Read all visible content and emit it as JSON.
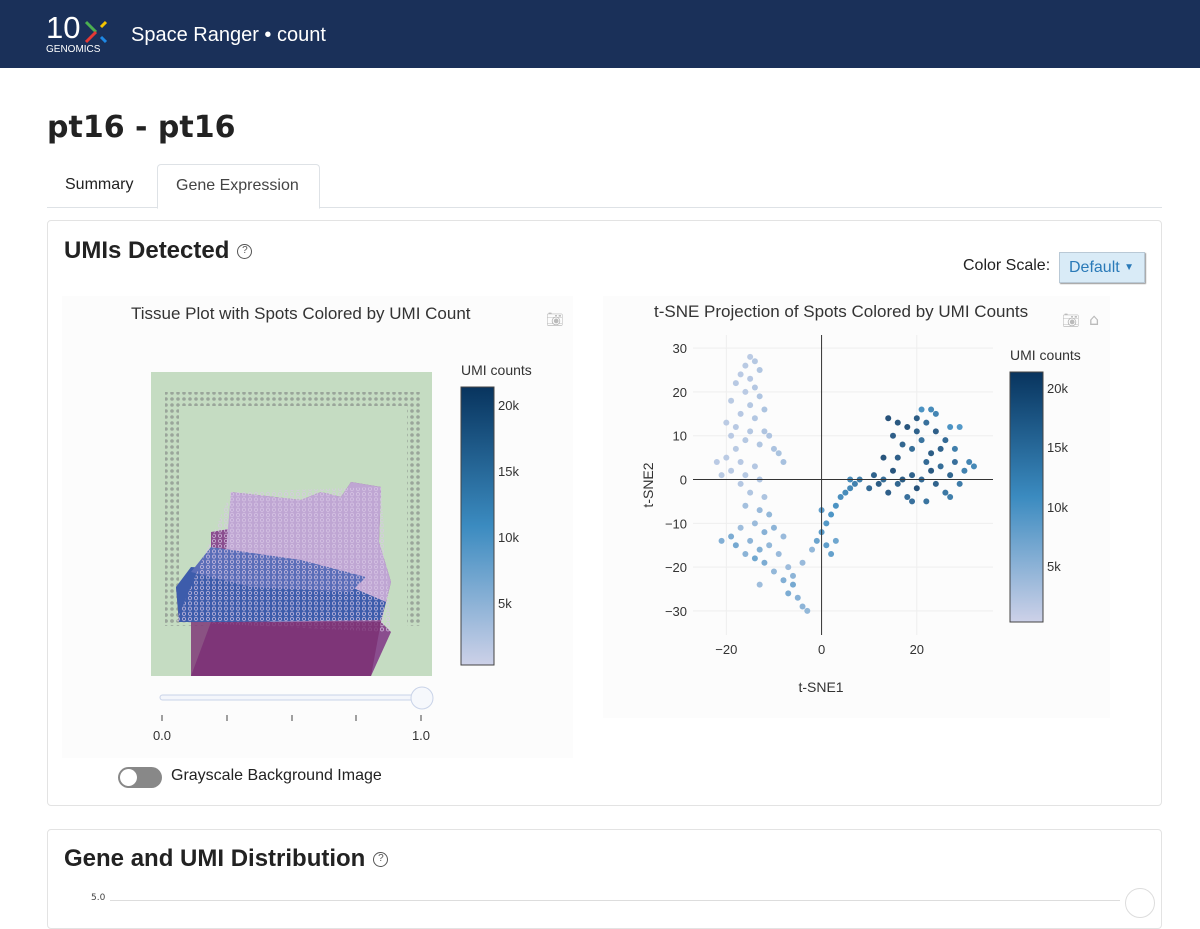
{
  "header": {
    "logo_text": "10x",
    "logo_subtext": "GENOMICS",
    "app_title": "Space Ranger • count"
  },
  "page": {
    "title": "pt16 - pt16"
  },
  "tabs": [
    {
      "label": "Summary",
      "active": false
    },
    {
      "label": "Gene Expression",
      "active": true
    }
  ],
  "umis_card": {
    "title": "UMIs Detected",
    "help_icon": "?",
    "color_scale_label": "Color Scale:",
    "color_scale_value": "Default",
    "tissue_plot": {
      "title": "Tissue Plot with Spots Colored by UMI Count",
      "colorbar_title": "UMI counts",
      "colorbar_ticks": [
        "20k",
        "15k",
        "10k",
        "5k"
      ],
      "opacity_slider": {
        "min_label": "0.0",
        "max_label": "1.0",
        "value": 1.0
      },
      "grayscale_toggle_label": "Grayscale Background Image",
      "grayscale_enabled": false
    },
    "tsne_plot": {
      "title": "t-SNE Projection of Spots Colored by UMI Counts",
      "colorbar_title": "UMI counts",
      "colorbar_ticks": [
        "20k",
        "15k",
        "10k",
        "5k"
      ]
    }
  },
  "dist_card": {
    "title": "Gene and UMI Distribution",
    "help_icon": "?",
    "partial_tick": "5.0"
  },
  "colors": {
    "header": "#1a3059",
    "scale_low": "#cdd1e8",
    "scale_mid": "#3b8bc0",
    "scale_high": "#08345e",
    "button_bg": "#d9ebf7"
  },
  "chart_data": {
    "type": "scatter",
    "title": "t-SNE Projection of Spots Colored by UMI Counts",
    "xlabel": "t-SNE1",
    "ylabel": "t-SNE2",
    "xticks": [
      -20,
      0,
      20
    ],
    "yticks": [
      30,
      20,
      10,
      0,
      -10,
      -20,
      -30
    ],
    "xlim": [
      -27,
      36
    ],
    "ylim": [
      -35.5,
      33
    ],
    "color_range": [
      0,
      23000
    ],
    "colorbar_title": "UMI counts",
    "grid": true,
    "points_x_y_umi": [
      [
        -15,
        28,
        2000
      ],
      [
        -14,
        27,
        2500
      ],
      [
        -16,
        26,
        2200
      ],
      [
        -13,
        25,
        2800
      ],
      [
        -17,
        24,
        2100
      ],
      [
        -15,
        23,
        2400
      ],
      [
        -14,
        21,
        2600
      ],
      [
        -18,
        22,
        2300
      ],
      [
        -16,
        20,
        2000
      ],
      [
        -13,
        19,
        3000
      ],
      [
        -19,
        18,
        2200
      ],
      [
        -15,
        17,
        2500
      ],
      [
        -12,
        16,
        3200
      ],
      [
        -17,
        15,
        2400
      ],
      [
        -14,
        14,
        2700
      ],
      [
        -20,
        13,
        2000
      ],
      [
        -18,
        12,
        2300
      ],
      [
        -15,
        11,
        2600
      ],
      [
        -12,
        11,
        3100
      ],
      [
        -11,
        10,
        3000
      ],
      [
        -19,
        10,
        2100
      ],
      [
        -16,
        9,
        2500
      ],
      [
        -13,
        8,
        2800
      ],
      [
        -18,
        7,
        2200
      ],
      [
        -10,
        7,
        3300
      ],
      [
        -9,
        6,
        3500
      ],
      [
        -20,
        5,
        2000
      ],
      [
        -17,
        4,
        2400
      ],
      [
        -14,
        3,
        2600
      ],
      [
        -8,
        4,
        3800
      ],
      [
        -22,
        4,
        2100
      ],
      [
        -19,
        2,
        2300
      ],
      [
        -16,
        1,
        2500
      ],
      [
        -21,
        1,
        2200
      ],
      [
        -13,
        0,
        3000
      ],
      [
        -17,
        -1,
        2600
      ],
      [
        -15,
        -3,
        2800
      ],
      [
        -12,
        -4,
        3200
      ],
      [
        -16,
        -6,
        4000
      ],
      [
        -13,
        -7,
        5000
      ],
      [
        -11,
        -8,
        5500
      ],
      [
        -14,
        -10,
        4800
      ],
      [
        -17,
        -11,
        4500
      ],
      [
        -10,
        -11,
        6000
      ],
      [
        -12,
        -12,
        6500
      ],
      [
        -19,
        -13,
        7500
      ],
      [
        -21,
        -14,
        7000
      ],
      [
        -18,
        -15,
        8000
      ],
      [
        -15,
        -14,
        6000
      ],
      [
        -13,
        -16,
        6800
      ],
      [
        -11,
        -15,
        5500
      ],
      [
        -8,
        -13,
        5000
      ],
      [
        -14,
        -18,
        8500
      ],
      [
        -12,
        -19,
        7500
      ],
      [
        -16,
        -17,
        6200
      ],
      [
        -9,
        -17,
        5000
      ],
      [
        -7,
        -20,
        4500
      ],
      [
        -10,
        -21,
        5500
      ],
      [
        -8,
        -23,
        7000
      ],
      [
        -6,
        -24,
        8000
      ],
      [
        -7,
        -26,
        7500
      ],
      [
        -5,
        -27,
        6500
      ],
      [
        -4,
        -29,
        6000
      ],
      [
        -3,
        -30,
        5500
      ],
      [
        -6,
        -22,
        6000
      ],
      [
        -13,
        -24,
        4500
      ],
      [
        -4,
        -19,
        5000
      ],
      [
        -2,
        -16,
        5500
      ],
      [
        -1,
        -14,
        9000
      ],
      [
        1,
        -15,
        10000
      ],
      [
        2,
        -17,
        9500
      ],
      [
        3,
        -14,
        8500
      ],
      [
        0,
        -12,
        10500
      ],
      [
        1,
        -10,
        11000
      ],
      [
        2,
        -8,
        11500
      ],
      [
        0,
        -7,
        10000
      ],
      [
        3,
        -6,
        12000
      ],
      [
        4,
        -4,
        12500
      ],
      [
        5,
        -3,
        13000
      ],
      [
        6,
        -2,
        13500
      ],
      [
        7,
        -1,
        14500
      ],
      [
        8,
        0,
        15000
      ],
      [
        6,
        0,
        13000
      ],
      [
        10,
        -2,
        18000
      ],
      [
        11,
        1,
        19000
      ],
      [
        12,
        -1,
        20000
      ],
      [
        13,
        0,
        17500
      ],
      [
        14,
        -3,
        19500
      ],
      [
        15,
        2,
        21000
      ],
      [
        16,
        -1,
        18500
      ],
      [
        17,
        0,
        20000
      ],
      [
        18,
        -4,
        17000
      ],
      [
        19,
        1,
        19000
      ],
      [
        20,
        -2,
        21500
      ],
      [
        21,
        0,
        18000
      ],
      [
        22,
        -5,
        16500
      ],
      [
        23,
        2,
        20500
      ],
      [
        24,
        -1,
        19000
      ],
      [
        25,
        3,
        17500
      ],
      [
        26,
        -3,
        16000
      ],
      [
        27,
        1,
        18500
      ],
      [
        28,
        4,
        17000
      ],
      [
        29,
        -1,
        15500
      ],
      [
        30,
        2,
        14500
      ],
      [
        31,
        4,
        14000
      ],
      [
        32,
        3,
        13500
      ],
      [
        28,
        7,
        15000
      ],
      [
        26,
        9,
        18000
      ],
      [
        24,
        11,
        19500
      ],
      [
        22,
        13,
        17000
      ],
      [
        20,
        14,
        20000
      ],
      [
        18,
        12,
        21000
      ],
      [
        16,
        13,
        20500
      ],
      [
        14,
        14,
        21500
      ],
      [
        15,
        10,
        19500
      ],
      [
        17,
        8,
        18500
      ],
      [
        19,
        7,
        17500
      ],
      [
        21,
        9,
        16500
      ],
      [
        23,
        6,
        20000
      ],
      [
        25,
        7,
        19000
      ],
      [
        27,
        12,
        12000
      ],
      [
        29,
        12,
        11000
      ],
      [
        23,
        16,
        13000
      ],
      [
        21,
        16,
        12000
      ],
      [
        24,
        15,
        14000
      ],
      [
        20,
        11,
        19000
      ],
      [
        13,
        5,
        21000
      ],
      [
        16,
        5,
        19500
      ],
      [
        22,
        4,
        18000
      ],
      [
        19,
        -5,
        17000
      ],
      [
        27,
        -4,
        15000
      ]
    ]
  }
}
